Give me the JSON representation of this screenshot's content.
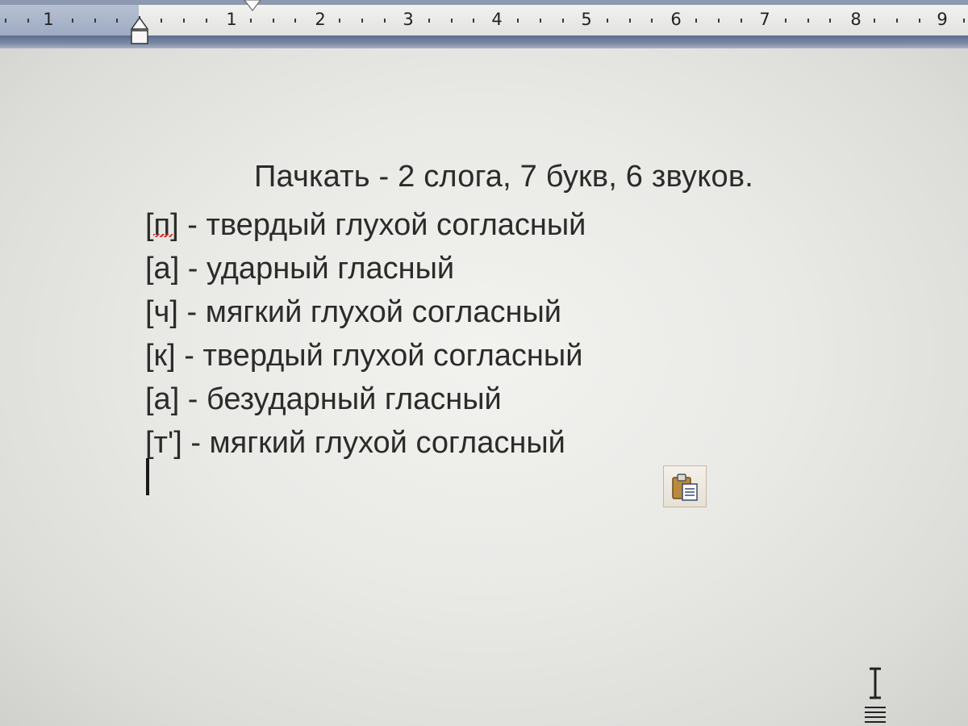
{
  "ruler": {
    "numbers": [
      "1",
      "1",
      "2",
      "3",
      "4",
      "5",
      "6",
      "7",
      "8",
      "9"
    ]
  },
  "document": {
    "title_line": "Пачкать - 2 слога, 7 букв, 6 звуков.",
    "lines": [
      {
        "sound": "[п]",
        "description": " - твердый глухой согласный",
        "spellcheck_error": true
      },
      {
        "sound": "[а]",
        "description": " - ударный гласный",
        "spellcheck_error": false
      },
      {
        "sound": "[ч]",
        "description": " - мягкий глухой согласный",
        "spellcheck_error": false
      },
      {
        "sound": "[к]",
        "description": " - твердый глухой согласный",
        "spellcheck_error": false
      },
      {
        "sound": "[а]",
        "description": " - безударный гласный",
        "spellcheck_error": false
      },
      {
        "sound": "[т']",
        "description": " - мягкий глухой согласный",
        "spellcheck_error": false
      }
    ]
  },
  "icons": {
    "paste_options": "paste-options-icon",
    "cursor": "ibeam-cursor-icon",
    "indent": "indent-marker-icon",
    "tab": "tab-stop-icon"
  },
  "colors": {
    "text": "#2b2b2b",
    "ruler_bar": "#6f7f98",
    "spellcheck": "#d22222"
  }
}
